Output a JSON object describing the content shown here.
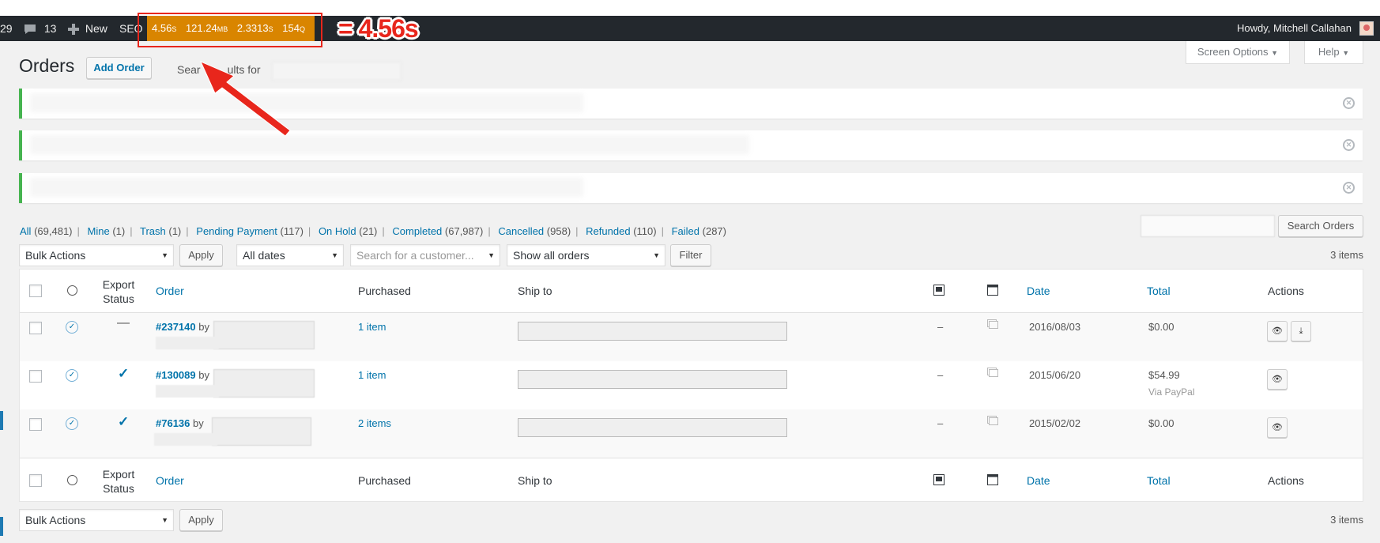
{
  "adminbar": {
    "updates_count": "29",
    "comments_count": "13",
    "new_label": "New",
    "seo_label": "SEO",
    "greeting": "Howdy, Mitchell Callahan"
  },
  "query_monitor": {
    "time": "4.56",
    "time_unit": "S",
    "memory": "121.24",
    "memory_unit": "MB",
    "db_time": "2.3313",
    "db_time_unit": "S",
    "queries": "154",
    "queries_unit": "Q"
  },
  "annotation": {
    "label": "= 4.56s",
    "color": "#e8261c"
  },
  "header": {
    "title": "Orders",
    "add_button": "Add Order",
    "search_results_prefix": "Sear",
    "search_results_suffix": "ults for"
  },
  "screen_meta": {
    "screen_options": "Screen Options",
    "help": "Help"
  },
  "status_filters": [
    {
      "label": "All",
      "count": "(69,481)"
    },
    {
      "label": "Mine",
      "count": "(1)"
    },
    {
      "label": "Trash",
      "count": "(1)"
    },
    {
      "label": "Pending Payment",
      "count": "(117)"
    },
    {
      "label": "On Hold",
      "count": "(21)"
    },
    {
      "label": "Completed",
      "count": "(67,987)"
    },
    {
      "label": "Cancelled",
      "count": "(958)"
    },
    {
      "label": "Refunded",
      "count": "(110)"
    },
    {
      "label": "Failed",
      "count": "(287)"
    }
  ],
  "search": {
    "button": "Search Orders"
  },
  "filters": {
    "bulk_actions": "Bulk Actions",
    "apply": "Apply",
    "dates": "All dates",
    "customer_placeholder": "Search for a customer...",
    "orders_type": "Show all orders",
    "filter": "Filter"
  },
  "items_count": "3 items",
  "columns": {
    "export_status": "Export Status",
    "order": "Order",
    "purchased": "Purchased",
    "ship_to": "Ship to",
    "date": "Date",
    "total": "Total",
    "actions": "Actions"
  },
  "orders": [
    {
      "number": "#237140",
      "by": "by",
      "purchased": "1 item",
      "dash": "–",
      "date": "2016/08/03",
      "total": "$0.00",
      "via": "",
      "exported": false
    },
    {
      "number": "#130089",
      "by": "by",
      "purchased": "1 item",
      "dash": "–",
      "date": "2015/06/20",
      "total": "$54.99",
      "via": "Via PayPal",
      "exported": true
    },
    {
      "number": "#76136",
      "by": "by",
      "purchased": "2 items",
      "dash": "–",
      "date": "2015/02/02",
      "total": "$0.00",
      "via": "",
      "exported": true
    }
  ],
  "bottom": {
    "bulk_actions": "Bulk Actions",
    "apply": "Apply",
    "items_count": "3 items"
  }
}
